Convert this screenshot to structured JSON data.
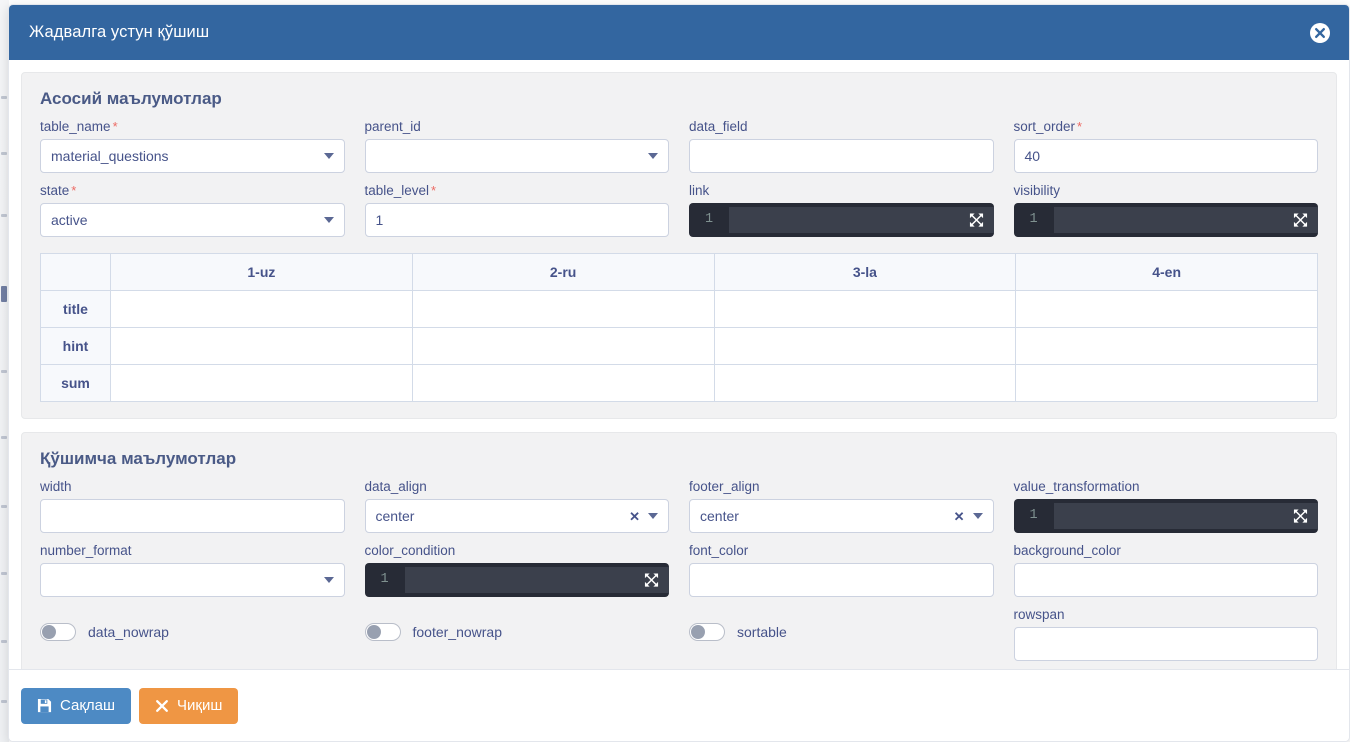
{
  "window": {
    "title": "Жадвалга устун қўшиш",
    "close_icon": "times-circle-icon",
    "header_color": "#3366a0"
  },
  "sections": [
    {
      "title": "Асосий маълумотлар",
      "fields": [
        {
          "label": "table_name",
          "required": true,
          "type": "select",
          "value": "material_questions",
          "clearable": false
        },
        {
          "label": "parent_id",
          "required": false,
          "type": "select",
          "value": "",
          "clearable": false
        },
        {
          "label": "data_field",
          "required": false,
          "type": "text",
          "value": ""
        },
        {
          "label": "sort_order",
          "required": true,
          "type": "text",
          "value": "40"
        },
        {
          "label": "state",
          "required": true,
          "type": "select",
          "value": "active",
          "clearable": false
        },
        {
          "label": "table_level",
          "required": true,
          "type": "text",
          "value": "1"
        },
        {
          "label": "link",
          "required": false,
          "type": "code",
          "value": "",
          "gutter": "1"
        },
        {
          "label": "visibility",
          "required": false,
          "type": "code",
          "value": "",
          "gutter": "1"
        }
      ]
    },
    {
      "title": "Қўшимча маълумотлар",
      "fields": [
        {
          "label": "width",
          "required": false,
          "type": "text",
          "value": ""
        },
        {
          "label": "data_align",
          "required": false,
          "type": "select",
          "value": "center",
          "clearable": true
        },
        {
          "label": "footer_align",
          "required": false,
          "type": "select",
          "value": "center",
          "clearable": true
        },
        {
          "label": "value_transformation",
          "required": false,
          "type": "code",
          "value": "",
          "gutter": "1"
        },
        {
          "label": "number_format",
          "required": false,
          "type": "select",
          "value": "",
          "clearable": false
        },
        {
          "label": "color_condition",
          "required": false,
          "type": "code",
          "value": "",
          "gutter": "1"
        },
        {
          "label": "font_color",
          "required": false,
          "type": "text",
          "value": ""
        },
        {
          "label": "background_color",
          "required": false,
          "type": "text",
          "value": ""
        },
        {
          "label": "rowspan",
          "required": false,
          "type": "text",
          "value": ""
        }
      ],
      "toggles": [
        {
          "label": "data_nowrap",
          "on": false
        },
        {
          "label": "footer_nowrap",
          "on": false
        },
        {
          "label": "sortable",
          "on": false
        }
      ]
    }
  ],
  "translations_table": {
    "columns": [
      "",
      "1-uz",
      "2-ru",
      "3-la",
      "4-en"
    ],
    "rows": [
      {
        "name": "title",
        "cells": [
          "",
          "",
          "",
          ""
        ]
      },
      {
        "name": "hint",
        "cells": [
          "",
          "",
          "",
          ""
        ]
      },
      {
        "name": "sum",
        "cells": [
          "",
          "",
          "",
          ""
        ]
      }
    ]
  },
  "footer": {
    "save_label": "Сақлаш",
    "save_icon": "save-icon",
    "save_color": "#4d8ac4",
    "exit_label": "Чиқиш",
    "exit_icon": "times-icon",
    "exit_color": "#ef9644"
  }
}
